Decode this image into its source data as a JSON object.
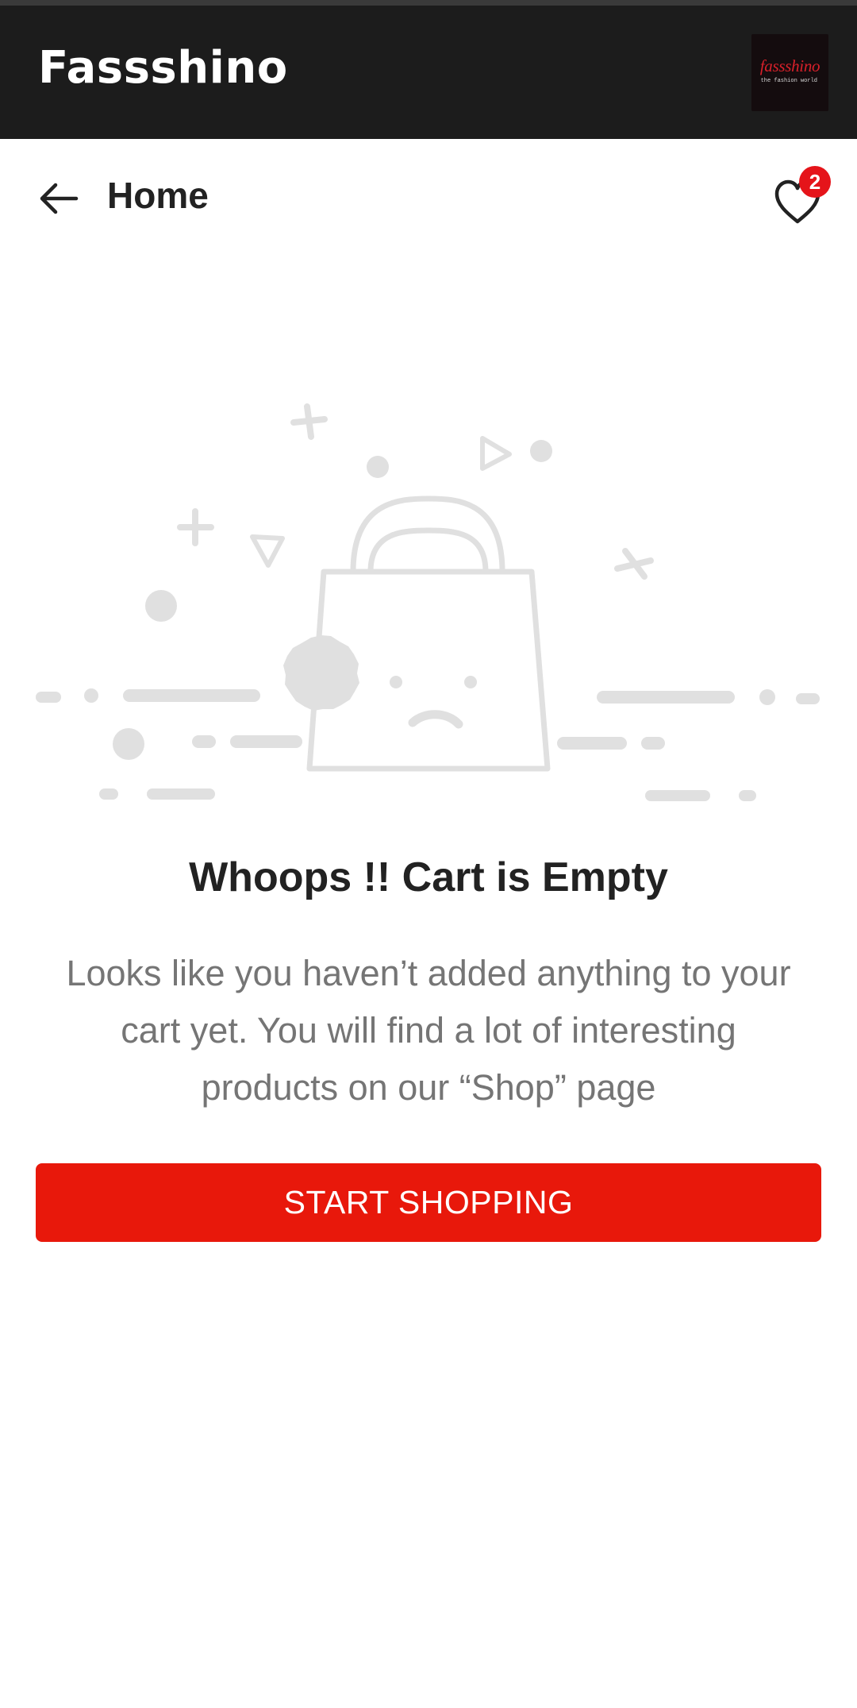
{
  "header": {
    "app_title": "Fassshino",
    "logo": {
      "icon": "fassshino-logo",
      "word": "fassshino",
      "tagline": "the fashion world"
    }
  },
  "nav": {
    "back_icon": "arrow-left-icon",
    "title": "Home",
    "wishlist_icon": "heart-icon",
    "wishlist_count": "2"
  },
  "empty_state": {
    "illustration": "sad-shopping-bag-illustration",
    "title": "Whoops !! Cart is Empty",
    "message": "Looks like you haven’t added anything to your cart yet. You will find a lot of interesting products on our “Shop” page",
    "button_label": "START SHOPPING"
  },
  "colors": {
    "header_bg": "#1c1c1c",
    "accent_red": "#e8180b",
    "illustration_gray": "#e0e0e0",
    "title_text": "#222222",
    "body_text": "#757575"
  }
}
